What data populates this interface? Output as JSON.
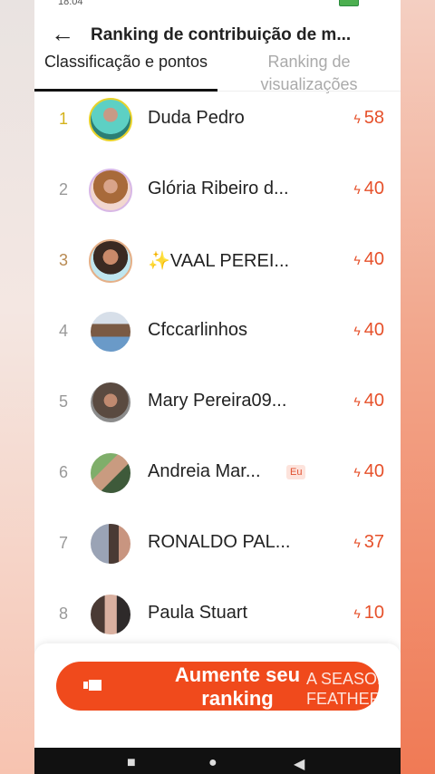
{
  "status": {
    "time": "18:04"
  },
  "header": {
    "back_label": "←",
    "title": "Ranking de contribuição de m..."
  },
  "tabs": [
    {
      "label": "Classificação e pontos"
    },
    {
      "label": "Ranking de visualizações"
    }
  ],
  "rows": [
    {
      "rank": "1",
      "name": "Duda Pedro",
      "score": "58",
      "badge": ""
    },
    {
      "rank": "2",
      "name": "Glória Ribeiro d...",
      "score": "40",
      "badge": ""
    },
    {
      "rank": "3",
      "name": "✨VAAL PEREI...",
      "score": "40",
      "badge": ""
    },
    {
      "rank": "4",
      "name": "Cfccarlinhos",
      "score": "40",
      "badge": ""
    },
    {
      "rank": "5",
      "name": "Mary Pereira09...",
      "score": "40",
      "badge": ""
    },
    {
      "rank": "6",
      "name": "Andreia Mar...",
      "score": "40",
      "badge": "Eu"
    },
    {
      "rank": "7",
      "name": "RONALDO PAL...",
      "score": "37",
      "badge": ""
    },
    {
      "rank": "8",
      "name": "Paula Stuart",
      "score": "10",
      "badge": ""
    }
  ],
  "cta": {
    "label": "Aumente seu ranking"
  },
  "overlay": {
    "line1": "A SEASON OF",
    "line2": "FEATHERS.FLO"
  },
  "colors": {
    "accent": "#f04a1c",
    "score": "#e6502a",
    "gold": "#d4b21a"
  },
  "icons": {
    "score": "bolt-icon",
    "cta": "video-icon",
    "back": "arrow-left-icon"
  }
}
